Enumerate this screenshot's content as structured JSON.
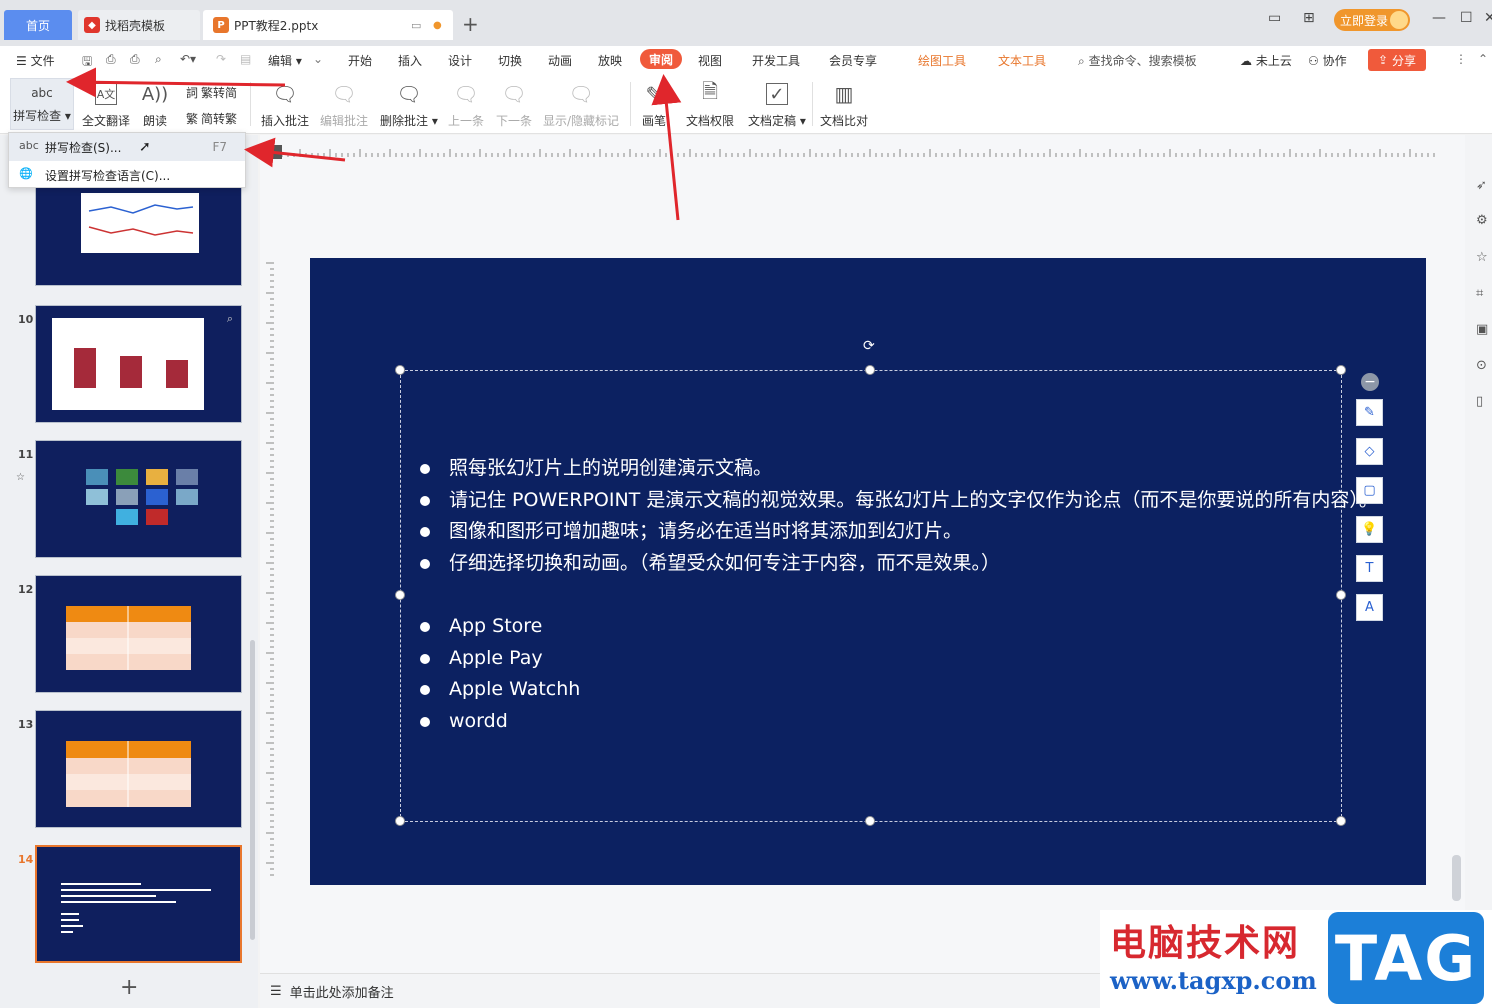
{
  "titlebar": {
    "tab_home": "首页",
    "tab_template": "找稻壳模板",
    "tab_doc": "PPT教程2.pptx",
    "login": "立即登录"
  },
  "menubar": {
    "file": "文件",
    "edit": "编辑",
    "items": [
      "开始",
      "插入",
      "设计",
      "切换",
      "动画",
      "放映",
      "审阅",
      "视图",
      "开发工具",
      "会员专享"
    ],
    "drawing_tools": "绘图工具",
    "text_tools": "文本工具",
    "search": "查找命令、搜索模板",
    "cloud": "未上云",
    "collab": "协作",
    "share": "分享"
  },
  "ribbon": {
    "spell_check": "拼写检查",
    "full_translate": "全文翻译",
    "read_aloud": "朗读",
    "trad_to_simp": "繁转简",
    "simp_to_trad": "简转繁",
    "insert_comment": "插入批注",
    "edit_comment": "编辑批注",
    "delete_comment": "删除批注",
    "prev": "上一条",
    "next": "下一条",
    "show_hide_marks": "显示/隐藏标记",
    "pen": "画笔",
    "doc_permission": "文档权限",
    "doc_finalize": "文档定稿",
    "doc_compare": "文档比对"
  },
  "dropdown": {
    "spell_check_item": "拼写检查(S)...",
    "spell_check_shortcut": "F7",
    "set_language_item": "设置拼写检查语言(C)..."
  },
  "thumbnails": {
    "numbers": [
      "10",
      "11",
      "12",
      "13",
      "14"
    ]
  },
  "slide": {
    "bullets_cn": [
      "照每张幻灯片上的说明创建演示文稿。",
      "请记住 POWERPOINT 是演示文稿的视觉效果。每张幻灯片上的文字仅作为论点（而不是你要说的所有内容）。",
      "图像和图形可增加趣味；请务必在适当时将其添加到幻灯片。",
      "仔细选择切换和动画。（希望受众如何专注于内容，而不是效果。）"
    ],
    "bullets_en": [
      "App Store",
      "Apple Pay",
      "Apple Watchh",
      "wordd"
    ]
  },
  "notes": {
    "placeholder": "单击此处添加备注"
  },
  "watermark": {
    "cn": "电脑技术网",
    "url": "www.tagxp.com",
    "tag": "TAG"
  },
  "colors": {
    "slide_bg": "#0c2161",
    "accent_red": "#f05a3b",
    "accent_orange": "#e8762c"
  }
}
